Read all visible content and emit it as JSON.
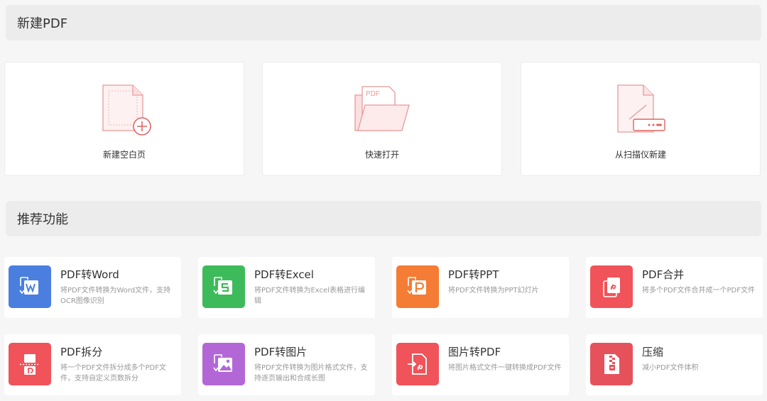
{
  "sections": {
    "new_pdf_title": "新建PDF",
    "recommend_title": "推荐功能"
  },
  "new_cards": [
    {
      "label": "新建空白页",
      "icon": "blank-page-add-icon"
    },
    {
      "label": "快速打开",
      "icon": "open-folder-pdf-icon"
    },
    {
      "label": "从扫描仪新建",
      "icon": "scanner-page-icon"
    }
  ],
  "features": [
    {
      "title": "PDF转Word",
      "desc": "将PDF文件转换为Word文件，支持OCR图像识别",
      "color": "#4a7fe0",
      "icon": "pdf-to-word-icon"
    },
    {
      "title": "PDF转Excel",
      "desc": "将PDF文件转换为Excel表格进行编辑",
      "color": "#3dbb5a",
      "icon": "pdf-to-excel-icon"
    },
    {
      "title": "PDF转PPT",
      "desc": "将PDF文件转换为PPT幻灯片",
      "color": "#f47c34",
      "icon": "pdf-to-ppt-icon"
    },
    {
      "title": "PDF合并",
      "desc": "将多个PDF文件合并成一个PDF文件",
      "color": "#f0535a",
      "icon": "pdf-merge-icon"
    },
    {
      "title": "PDF拆分",
      "desc": "将一个PDF文件拆分成多个PDF文件，支持自定义页数拆分",
      "color": "#f0535a",
      "icon": "pdf-split-icon"
    },
    {
      "title": "PDF转图片",
      "desc": "将PDF文件转换为图片格式文件，支持逐页输出和合成长图",
      "color": "#b367d6",
      "icon": "pdf-to-image-icon"
    },
    {
      "title": "图片转PDF",
      "desc": "将图片格式文件一键转换成PDF文件",
      "color": "#f0535a",
      "icon": "image-to-pdf-icon"
    },
    {
      "title": "压缩",
      "desc": "减小PDF文件体积",
      "color": "#e5525c",
      "icon": "compress-icon"
    }
  ]
}
